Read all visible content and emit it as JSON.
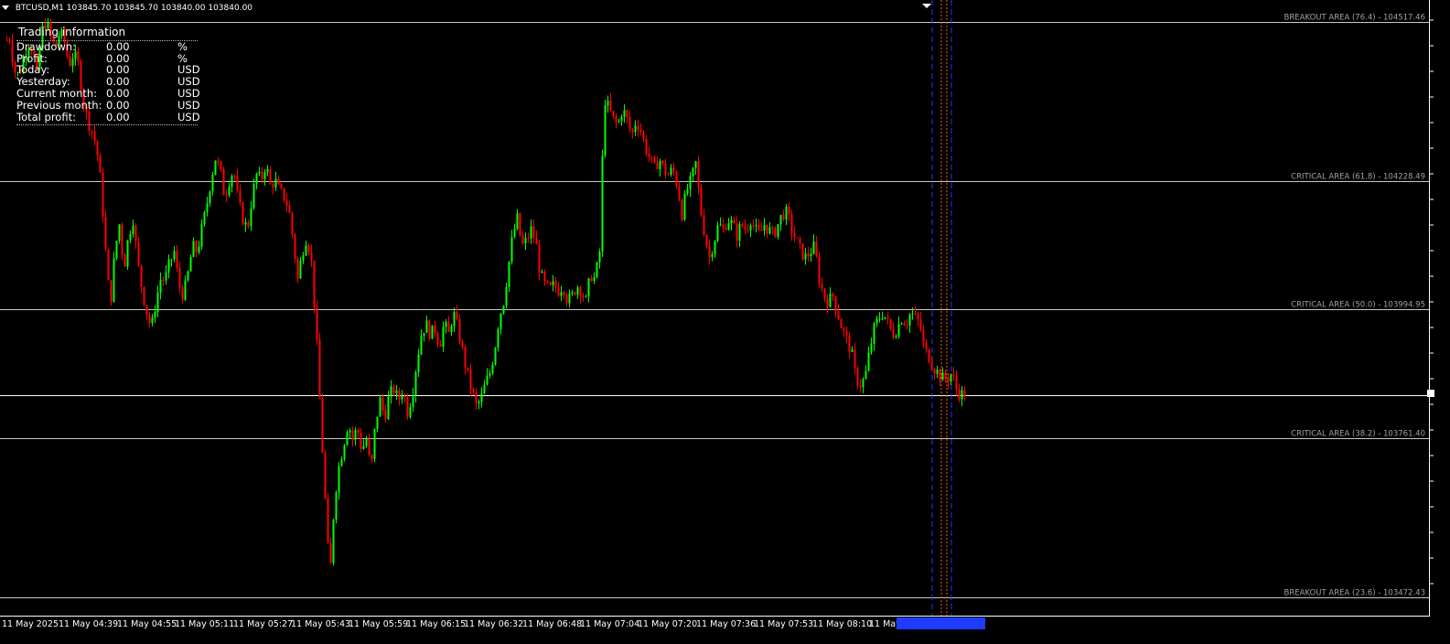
{
  "chart_header": {
    "symbol_tf": "BTCUSD,M1",
    "ohlc": "103845.70 103845.70 103840.00 103840.00"
  },
  "trading_info": {
    "title": "Trading information",
    "rows": [
      {
        "label": "Drawdown:",
        "value": "0.00",
        "unit": "%"
      },
      {
        "label": "Profit:",
        "value": "0.00",
        "unit": "%"
      },
      {
        "label": "Today:",
        "value": "0.00",
        "unit": "USD"
      },
      {
        "label": "Yesterday:",
        "value": "0.00",
        "unit": "USD"
      },
      {
        "label": "Current month:",
        "value": "0.00",
        "unit": "USD"
      },
      {
        "label": "Previous month:",
        "value": "0.00",
        "unit": "USD"
      },
      {
        "label": "Total profit:",
        "value": "0.00",
        "unit": "USD"
      }
    ]
  },
  "levels": [
    {
      "label": "BREAKOUT AREA (76.4) - 104517.46",
      "price": 104517.46
    },
    {
      "label": "CRITICAL AREA (61.8) - 104228.49",
      "price": 104228.49
    },
    {
      "label": "CRITICAL AREA (50.0) - 103994.95",
      "price": 103994.95
    },
    {
      "label": "CRITICAL AREA (38.2) - 103761.40",
      "price": 103761.4
    },
    {
      "label": "BREAKOUT AREA (23.6) - 103472.43",
      "price": 103472.43
    }
  ],
  "current_price": 103840.0,
  "time_axis": [
    "11 May 2025",
    "11 May 04:39",
    "11 May 04:55",
    "11 May 05:11",
    "11 May 05:27",
    "11 May 05:43",
    "11 May 05:59",
    "11 May 06:15",
    "11 May 06:32",
    "11 May 06:48",
    "11 May 07:04",
    "11 May 07:20",
    "11 May 07:36",
    "11 May 07:53",
    "11 May 08:10",
    "11 May"
  ],
  "colors": {
    "background": "#000000",
    "bull": "#00ff00",
    "bear": "#ff0000",
    "level_line": "#c8c8c8",
    "level_text": "#a0a0a0",
    "vline_blue": "#1e3cff",
    "vline_orange": "#ff5a00"
  },
  "chart_data": {
    "type": "candlestick",
    "symbol": "BTCUSD",
    "timeframe": "M1",
    "ylim": [
      103460,
      104530
    ],
    "close_path": [
      [
        0,
        104440
      ],
      [
        5,
        104480
      ],
      [
        10,
        104490
      ],
      [
        15,
        104430
      ],
      [
        20,
        104420
      ],
      [
        25,
        104450
      ],
      [
        30,
        104480
      ],
      [
        35,
        104470
      ],
      [
        40,
        104420
      ],
      [
        45,
        104500
      ],
      [
        50,
        104520
      ],
      [
        55,
        104490
      ],
      [
        60,
        104470
      ],
      [
        65,
        104500
      ],
      [
        70,
        104480
      ],
      [
        75,
        104440
      ],
      [
        80,
        104460
      ],
      [
        85,
        104440
      ],
      [
        90,
        104380
      ],
      [
        95,
        104340
      ],
      [
        100,
        104320
      ],
      [
        105,
        104290
      ],
      [
        110,
        104220
      ],
      [
        115,
        104100
      ],
      [
        120,
        104000
      ],
      [
        125,
        104100
      ],
      [
        130,
        104150
      ],
      [
        135,
        104070
      ],
      [
        140,
        104130
      ],
      [
        145,
        104160
      ],
      [
        150,
        104080
      ],
      [
        155,
        104030
      ],
      [
        160,
        103990
      ],
      [
        165,
        103960
      ],
      [
        170,
        104010
      ],
      [
        175,
        104050
      ],
      [
        180,
        104050
      ],
      [
        185,
        104080
      ],
      [
        190,
        104100
      ],
      [
        195,
        104040
      ],
      [
        200,
        104020
      ],
      [
        205,
        104060
      ],
      [
        210,
        104110
      ],
      [
        215,
        104100
      ],
      [
        220,
        104140
      ],
      [
        225,
        104180
      ],
      [
        230,
        104230
      ],
      [
        235,
        104270
      ],
      [
        240,
        104250
      ],
      [
        245,
        104200
      ],
      [
        250,
        104230
      ],
      [
        255,
        104250
      ],
      [
        260,
        104190
      ],
      [
        265,
        104160
      ],
      [
        270,
        104140
      ],
      [
        275,
        104200
      ],
      [
        280,
        104240
      ],
      [
        285,
        104230
      ],
      [
        290,
        104260
      ],
      [
        295,
        104220
      ],
      [
        300,
        104230
      ],
      [
        305,
        104210
      ],
      [
        310,
        104200
      ],
      [
        315,
        104180
      ],
      [
        320,
        104120
      ],
      [
        325,
        104050
      ],
      [
        330,
        104100
      ],
      [
        335,
        104130
      ],
      [
        340,
        104080
      ],
      [
        345,
        103960
      ],
      [
        350,
        103800
      ],
      [
        355,
        103650
      ],
      [
        360,
        103500
      ],
      [
        365,
        103650
      ],
      [
        370,
        103710
      ],
      [
        375,
        103750
      ],
      [
        380,
        103790
      ],
      [
        385,
        103760
      ],
      [
        390,
        103780
      ],
      [
        395,
        103740
      ],
      [
        400,
        103760
      ],
      [
        405,
        103700
      ],
      [
        410,
        103790
      ],
      [
        415,
        103830
      ],
      [
        420,
        103800
      ],
      [
        425,
        103840
      ],
      [
        430,
        103850
      ],
      [
        435,
        103830
      ],
      [
        440,
        103850
      ],
      [
        445,
        103810
      ],
      [
        450,
        103840
      ],
      [
        455,
        103900
      ],
      [
        460,
        103950
      ],
      [
        465,
        103970
      ],
      [
        470,
        103950
      ],
      [
        475,
        103960
      ],
      [
        480,
        103930
      ],
      [
        485,
        103970
      ],
      [
        490,
        103950
      ],
      [
        495,
        103990
      ],
      [
        500,
        103960
      ],
      [
        505,
        103920
      ],
      [
        510,
        103880
      ],
      [
        515,
        103850
      ],
      [
        520,
        103820
      ],
      [
        525,
        103830
      ],
      [
        530,
        103860
      ],
      [
        535,
        103880
      ],
      [
        540,
        103920
      ],
      [
        545,
        103980
      ],
      [
        550,
        104010
      ],
      [
        555,
        104070
      ],
      [
        560,
        104130
      ],
      [
        565,
        104160
      ],
      [
        570,
        104110
      ],
      [
        575,
        104120
      ],
      [
        580,
        104140
      ],
      [
        585,
        104120
      ],
      [
        590,
        104060
      ],
      [
        595,
        104040
      ],
      [
        600,
        104030
      ],
      [
        605,
        104040
      ],
      [
        610,
        104030
      ],
      [
        615,
        104040
      ],
      [
        620,
        104010
      ],
      [
        625,
        104020
      ],
      [
        630,
        104040
      ],
      [
        635,
        104030
      ],
      [
        640,
        104010
      ],
      [
        645,
        104060
      ],
      [
        650,
        104050
      ],
      [
        655,
        104100
      ],
      [
        660,
        104380
      ],
      [
        665,
        104360
      ],
      [
        670,
        104340
      ],
      [
        675,
        104330
      ],
      [
        680,
        104360
      ],
      [
        685,
        104340
      ],
      [
        690,
        104310
      ],
      [
        695,
        104340
      ],
      [
        700,
        104320
      ],
      [
        705,
        104290
      ],
      [
        710,
        104270
      ],
      [
        715,
        104250
      ],
      [
        720,
        104270
      ],
      [
        725,
        104250
      ],
      [
        730,
        104240
      ],
      [
        735,
        104250
      ],
      [
        740,
        104220
      ],
      [
        745,
        104170
      ],
      [
        750,
        104210
      ],
      [
        755,
        104230
      ],
      [
        760,
        104260
      ],
      [
        765,
        104180
      ],
      [
        770,
        104130
      ],
      [
        775,
        104090
      ],
      [
        780,
        104120
      ],
      [
        785,
        104150
      ],
      [
        790,
        104140
      ],
      [
        795,
        104160
      ],
      [
        800,
        104150
      ],
      [
        805,
        104130
      ],
      [
        810,
        104150
      ],
      [
        815,
        104140
      ],
      [
        820,
        104160
      ],
      [
        825,
        104140
      ],
      [
        830,
        104130
      ],
      [
        835,
        104150
      ],
      [
        840,
        104140
      ],
      [
        845,
        104130
      ],
      [
        850,
        104150
      ],
      [
        855,
        104170
      ],
      [
        860,
        104170
      ],
      [
        865,
        104140
      ],
      [
        870,
        104120
      ],
      [
        875,
        104100
      ],
      [
        880,
        104090
      ],
      [
        885,
        104100
      ],
      [
        890,
        104110
      ],
      [
        895,
        104050
      ],
      [
        900,
        104020
      ],
      [
        905,
        104010
      ],
      [
        910,
        104020
      ],
      [
        915,
        103990
      ],
      [
        920,
        103960
      ],
      [
        925,
        103940
      ],
      [
        930,
        103920
      ],
      [
        935,
        103870
      ],
      [
        940,
        103860
      ],
      [
        945,
        103870
      ],
      [
        950,
        103920
      ],
      [
        955,
        103960
      ],
      [
        960,
        103980
      ],
      [
        965,
        103990
      ],
      [
        970,
        103970
      ],
      [
        975,
        103950
      ],
      [
        980,
        103960
      ],
      [
        985,
        103980
      ],
      [
        990,
        103970
      ],
      [
        995,
        103990
      ],
      [
        1000,
        103980
      ],
      [
        1005,
        103970
      ],
      [
        1010,
        103920
      ],
      [
        1015,
        103910
      ],
      [
        1020,
        103890
      ],
      [
        1025,
        103880
      ],
      [
        1030,
        103870
      ],
      [
        1035,
        103870
      ],
      [
        1040,
        103880
      ],
      [
        1045,
        103850
      ],
      [
        1050,
        103840
      ],
      [
        1055,
        103845
      ]
    ]
  }
}
